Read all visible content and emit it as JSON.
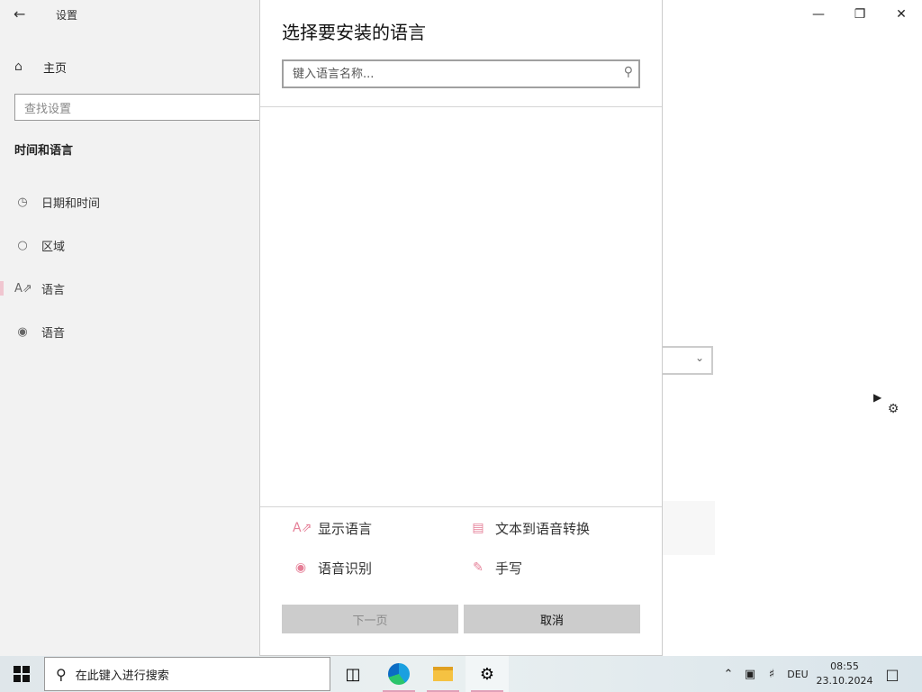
{
  "settings": {
    "app_title": "设置",
    "home_label": "主页",
    "search_placeholder": "查找设置",
    "section_title": "时间和语言",
    "nav_items": [
      {
        "label": "日期和时间",
        "icon": "calendar-clock-icon"
      },
      {
        "label": "区域",
        "icon": "globe-icon"
      },
      {
        "label": "语言",
        "icon": "language-icon"
      },
      {
        "label": "语音",
        "icon": "microphone-icon"
      }
    ],
    "active_nav_index": 2
  },
  "dialog": {
    "title": "选择要安装的语言",
    "search_placeholder": "键入语言名称...",
    "search_value": "",
    "features": [
      {
        "label": "显示语言",
        "icon": "display-language-icon"
      },
      {
        "label": "文本到语音转换",
        "icon": "text-to-speech-icon"
      },
      {
        "label": "语音识别",
        "icon": "microphone-icon"
      },
      {
        "label": "手写",
        "icon": "handwriting-icon"
      }
    ],
    "next_button": "下一页",
    "cancel_button": "取消"
  },
  "taskbar": {
    "search_placeholder": "在此键入进行搜索",
    "apps": [
      {
        "name": "task-view",
        "icon": "task-view-icon"
      },
      {
        "name": "edge",
        "icon": "edge-icon"
      },
      {
        "name": "file-explorer",
        "icon": "folder-icon"
      },
      {
        "name": "settings",
        "icon": "gear-icon"
      }
    ],
    "language_indicator": "DEU",
    "time": "08:55",
    "date": "23.10.2024"
  },
  "colors": {
    "accent_pink": "#e57f97",
    "sidebar_bg": "#f2f2f2",
    "button_bg": "#cccccc"
  }
}
